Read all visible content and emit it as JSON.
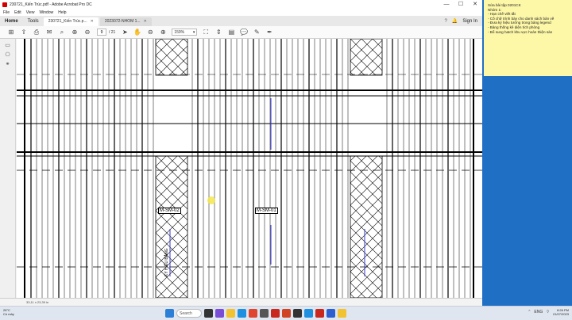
{
  "window": {
    "title": "230721_Kiến Trúc.pdf - Adobe Acrobat Pro DC",
    "controls": [
      "—",
      "☐",
      "✕"
    ]
  },
  "menu": [
    "File",
    "Edit",
    "View",
    "Window",
    "Help"
  ],
  "tabs": {
    "home": "Home",
    "tools": "Tools",
    "doc1": "230721_Kiến Trúc.p...",
    "doc2": "2023072-NHOM 1...",
    "sign_in": "Sign In"
  },
  "toolbar": {
    "page_current": "9",
    "page_total": "/ 21",
    "zoom": "159%"
  },
  "drawing": {
    "label_left": "M-SM-02",
    "label_right": "M-SM-01",
    "vertical_text": "KÝ HIỆU BẢNG"
  },
  "status": {
    "dimensions": "33,11 x 23,39 in"
  },
  "sticky_note": {
    "lines": [
      "Sửa bài tập 0201CK",
      "Nhóm 1:",
      "- Hạn chế viết tắt",
      "- Cố chữ trình bày cho danh sách bản vẽ",
      "- Đưa ký hiệu tường trong bảng legend",
      "- Bảng thống kê diện tích phòng",
      "- Bổ sung hatch khu vực hoàn thiện sàn"
    ]
  },
  "taskbar": {
    "weather_temp": "26°C",
    "weather_desc": "Có mây",
    "search": "Search",
    "time": "8:26 PM",
    "date": "21/07/2023",
    "lang": "ENG"
  }
}
